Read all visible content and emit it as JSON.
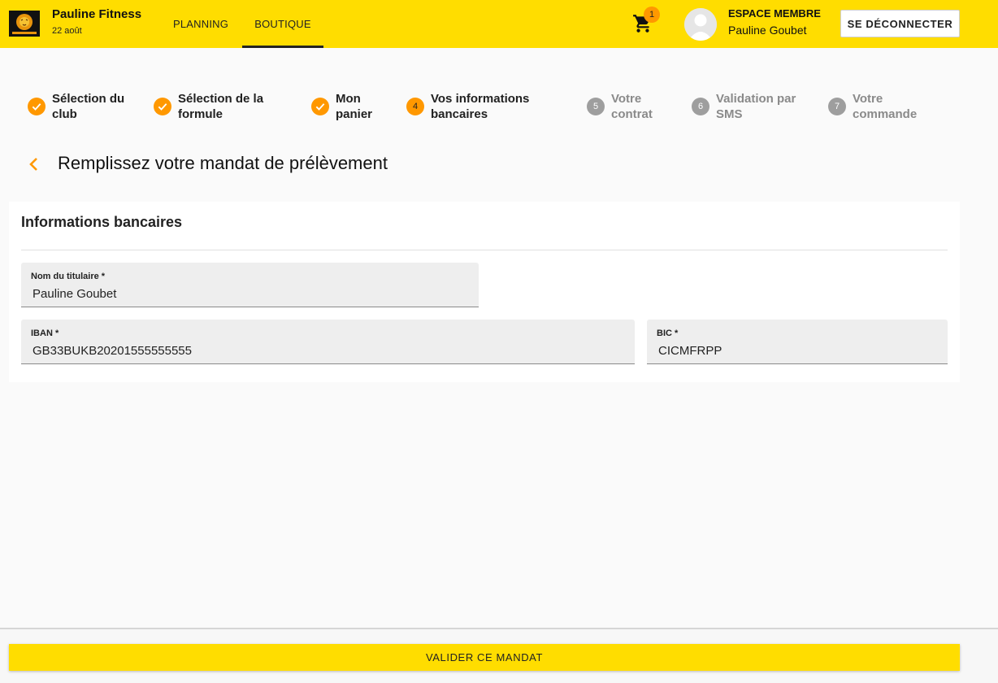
{
  "header": {
    "brand_name": "Pauline Fitness",
    "date": "22 août",
    "nav": [
      {
        "label": "PLANNING",
        "active": false
      },
      {
        "label": "BOUTIQUE",
        "active": true
      }
    ],
    "cart_count": "1",
    "member_label": "ESPACE MEMBRE",
    "member_name": "Pauline Goubet",
    "logout_label": "SE DÉCONNECTER"
  },
  "steps": [
    {
      "number": "1",
      "label": "Sélection du club",
      "status": "done"
    },
    {
      "number": "2",
      "label": "Sélection de la formule",
      "status": "done"
    },
    {
      "number": "3",
      "label": "Mon panier",
      "status": "done"
    },
    {
      "number": "4",
      "label": "Vos informations bancaires",
      "status": "active"
    },
    {
      "number": "5",
      "label": "Votre contrat",
      "status": "todo"
    },
    {
      "number": "6",
      "label": "Validation par SMS",
      "status": "todo"
    },
    {
      "number": "7",
      "label": "Votre commande",
      "status": "todo"
    }
  ],
  "page": {
    "title": "Remplissez votre mandat de prélèvement"
  },
  "form": {
    "section_title": "Informations bancaires",
    "holder": {
      "label": "Nom du titulaire *",
      "value": "Pauline Goubet"
    },
    "iban": {
      "label": "IBAN *",
      "value": "GB33BUKB20201555555555"
    },
    "bic": {
      "label": "BIC *",
      "value": "CICMFRPP"
    }
  },
  "footer": {
    "submit_label": "VALIDER CE MANDAT"
  },
  "colors": {
    "primary": "#ffdd00",
    "accent": "#ff9800",
    "step_inactive": "#9e9e9e"
  },
  "icons": {
    "logo": "lion-logo-icon",
    "cart": "shopping-cart-icon",
    "avatar": "user-avatar-icon",
    "step_done": "checkmark-icon",
    "back": "chevron-left-icon"
  }
}
